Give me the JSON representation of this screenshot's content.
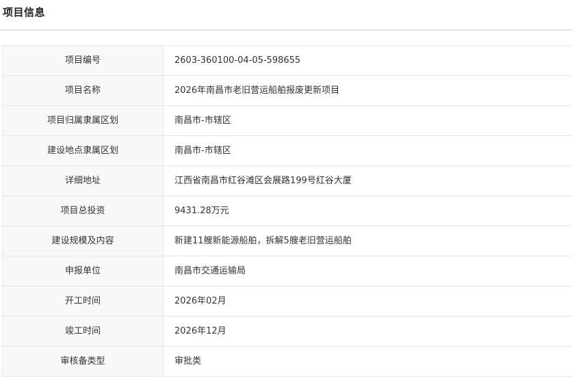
{
  "section": {
    "title": "项目信息"
  },
  "rows": [
    {
      "label": "项目编号",
      "value": "2603-360100-04-05-598655"
    },
    {
      "label": "项目名称",
      "value": "2026年南昌市老旧营运船舶报废更新项目"
    },
    {
      "label": "项目归属隶属区划",
      "value": "南昌市-市辖区"
    },
    {
      "label": "建设地点隶属区划",
      "value": "南昌市-市辖区"
    },
    {
      "label": "详细地址",
      "value": "江西省南昌市红谷滩区会展路199号红谷大厦"
    },
    {
      "label": "项目总投资",
      "value": "9431.28万元"
    },
    {
      "label": "建设规模及内容",
      "value": "新建11艘新能源船舶，拆解5艘老旧营运船舶"
    },
    {
      "label": "申报单位",
      "value": "南昌市交通运输局"
    },
    {
      "label": "开工时间",
      "value": "2026年02月"
    },
    {
      "label": "竣工时间",
      "value": "2026年12月"
    },
    {
      "label": "审核备类型",
      "value": "审批类"
    }
  ]
}
